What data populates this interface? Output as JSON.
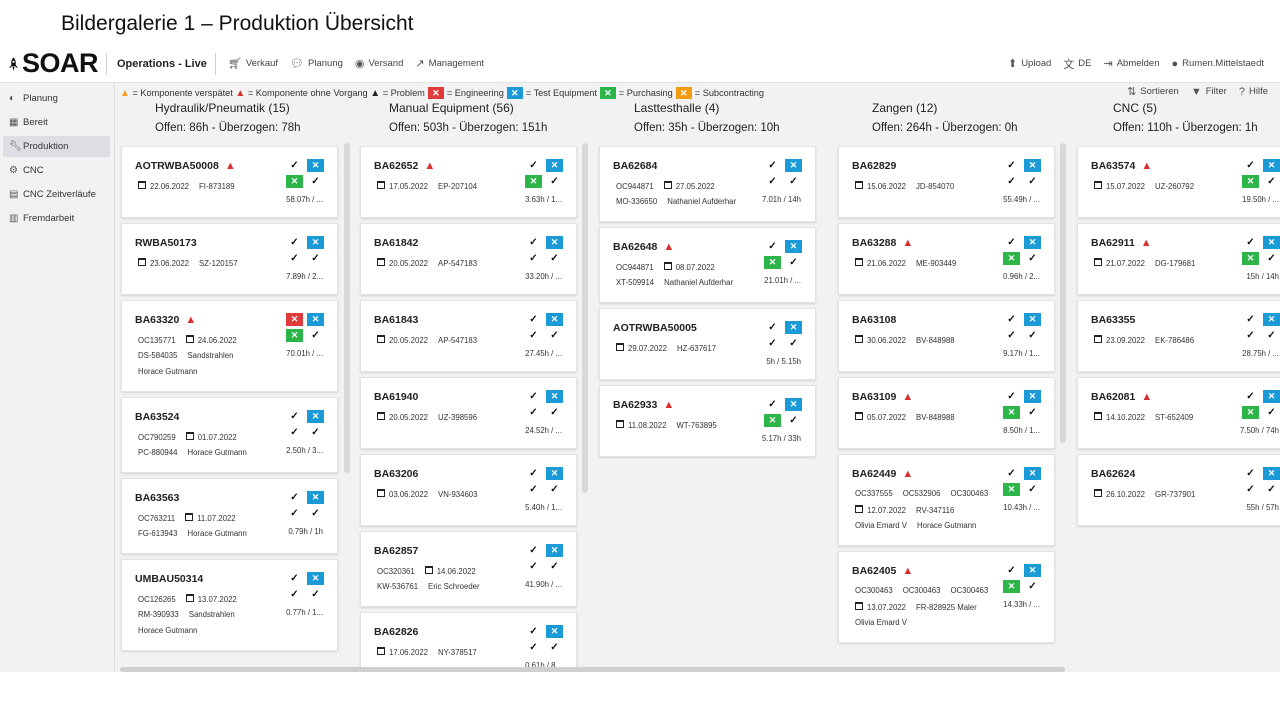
{
  "slide_title": "Bildergalerie 1 – Produktion Übersicht",
  "brand": "SOAR",
  "app_title": "Operations - Live",
  "nav": [
    {
      "label": "Verkauf",
      "icon": "cart-icon"
    },
    {
      "label": "Planung",
      "icon": "chat-icon"
    },
    {
      "label": "Versand",
      "icon": "globe-icon"
    },
    {
      "label": "Management",
      "icon": "trend-icon"
    }
  ],
  "top_right": [
    {
      "label": "Upload",
      "icon": "upload-icon"
    },
    {
      "label": "DE",
      "icon": "translate-icon"
    },
    {
      "label": "Abmelden",
      "icon": "logout-icon"
    },
    {
      "label": "Rumen.Mittelstaedt",
      "icon": "user-icon"
    }
  ],
  "sidebar": [
    {
      "label": "Planung",
      "icon": "palette-icon",
      "active": false
    },
    {
      "label": "Bereit",
      "icon": "pallet-icon",
      "active": false
    },
    {
      "label": "Produktion",
      "icon": "wrench-icon",
      "active": true
    },
    {
      "label": "CNC",
      "icon": "gears-icon",
      "active": false
    },
    {
      "label": "CNC Zeitverläufe",
      "icon": "calendar-icon",
      "active": false
    },
    {
      "label": "Fremdarbeit",
      "icon": "building-icon",
      "active": false
    }
  ],
  "legend": {
    "late": "= Komponente verspätet",
    "no_process": "= Komponente ohne Vorgang",
    "problem": "= Problem",
    "engineering": "= Engineering",
    "test_equipment": "= Test Equipment",
    "purchasing": "= Purchasing",
    "subcontracting": "= Subcontracting"
  },
  "tools": {
    "sort": "Sortieren",
    "filter": "Filter",
    "help": "Hilfe"
  },
  "colors": {
    "blue": "#1a9ad6",
    "red": "#e03b3b",
    "green": "#2db54a",
    "orange": "#f39c12"
  },
  "columns": [
    {
      "title": "Hydraulik/Pneumatik (15)",
      "summary": "Offen: 86h - Überzogen: 78h",
      "cards": [
        {
          "id": "AOTRWBA50008",
          "warn": true,
          "lines": [
            [
              "",
              "22.06.2022",
              "FI-873189"
            ]
          ],
          "flags": [
            "check",
            "x-blue",
            "x-green",
            "check"
          ],
          "hours": "58.07h / ..."
        },
        {
          "id": "RWBA50173",
          "warn": false,
          "lines": [
            [
              "",
              "23.06.2022",
              "SZ-120157"
            ]
          ],
          "flags": [
            "check",
            "x-blue",
            "check",
            "check"
          ],
          "hours": "7.89h / 2..."
        },
        {
          "id": "BA63320",
          "warn": true,
          "lines": [
            [
              "OC135771",
              "24.06.2022",
              ""
            ],
            [
              "DS-584035",
              "",
              "Sandstrahlen"
            ],
            [
              "Horace Gutmann",
              "",
              ""
            ]
          ],
          "flags": [
            "x-red",
            "x-blue",
            "x-green",
            "check"
          ],
          "hours": "70.01h / ..."
        },
        {
          "id": "BA63524",
          "warn": false,
          "lines": [
            [
              "OC790259",
              "01.07.2022",
              ""
            ],
            [
              "PC-880944",
              "",
              "Horace Gutmann"
            ]
          ],
          "flags": [
            "check",
            "x-blue",
            "check",
            "check"
          ],
          "hours": "2.50h / 3..."
        },
        {
          "id": "BA63563",
          "warn": false,
          "lines": [
            [
              "OC763211",
              "11.07.2022",
              ""
            ],
            [
              "FG-613943",
              "",
              "Horace Gutmann"
            ]
          ],
          "flags": [
            "check",
            "x-blue",
            "check",
            "check"
          ],
          "hours": "0.79h / 1h"
        },
        {
          "id": "UMBAU50314",
          "warn": false,
          "lines": [
            [
              "OC126265",
              "13.07.2022",
              ""
            ],
            [
              "RM-390933",
              "",
              "Sandstrahlen"
            ],
            [
              "Horace Gutmann",
              "",
              ""
            ]
          ],
          "flags": [
            "check",
            "x-blue",
            "check",
            "check"
          ],
          "hours": "0.77h / 1..."
        }
      ]
    },
    {
      "title": "Manual Equipment (56)",
      "summary": "Offen: 503h - Überzogen: 151h",
      "cards": [
        {
          "id": "BA62652",
          "warn": true,
          "lines": [
            [
              "",
              "17.05.2022",
              "EP-207104"
            ]
          ],
          "flags": [
            "check",
            "x-blue",
            "x-green",
            "check"
          ],
          "hours": "3.63h / 1..."
        },
        {
          "id": "BA61842",
          "warn": false,
          "lines": [
            [
              "",
              "20.05.2022",
              "AP-547183"
            ]
          ],
          "flags": [
            "check",
            "x-blue",
            "check",
            "check"
          ],
          "hours": "33.20h / ..."
        },
        {
          "id": "BA61843",
          "warn": false,
          "lines": [
            [
              "",
              "20.05.2022",
              "AP-547183"
            ]
          ],
          "flags": [
            "check",
            "x-blue",
            "check",
            "check"
          ],
          "hours": "27.45h / ..."
        },
        {
          "id": "BA61940",
          "warn": false,
          "lines": [
            [
              "",
              "20.05.2022",
              "UZ-398596"
            ]
          ],
          "flags": [
            "check",
            "x-blue",
            "check",
            "check"
          ],
          "hours": "24.52h / ..."
        },
        {
          "id": "BA63206",
          "warn": false,
          "lines": [
            [
              "",
              "03.06.2022",
              "VN-934603"
            ]
          ],
          "flags": [
            "check",
            "x-blue",
            "check",
            "check"
          ],
          "hours": "5.40h / 1..."
        },
        {
          "id": "BA62857",
          "warn": false,
          "lines": [
            [
              "OC320361",
              "14.06.2022",
              ""
            ],
            [
              "KW-536761",
              "",
              "Eric Schroeder"
            ]
          ],
          "flags": [
            "check",
            "x-blue",
            "check",
            "check"
          ],
          "hours": "41.90h / ..."
        },
        {
          "id": "BA62826",
          "warn": false,
          "lines": [
            [
              "",
              "17.06.2022",
              "NY-378517"
            ]
          ],
          "flags": [
            "check",
            "x-blue",
            "check",
            "check"
          ],
          "hours": "0.61h / 8..."
        }
      ]
    },
    {
      "title": "Lasttesthalle (4)",
      "summary": "Offen: 35h - Überzogen: 10h",
      "cards": [
        {
          "id": "BA62684",
          "warn": false,
          "lines": [
            [
              "OC944871",
              "27.05.2022",
              ""
            ],
            [
              "MO-336650",
              "",
              "Nathaniel Aufderhar"
            ]
          ],
          "flags": [
            "check",
            "x-blue",
            "check",
            "check"
          ],
          "hours": "7.01h / 14h"
        },
        {
          "id": "BA62648",
          "warn": true,
          "lines": [
            [
              "OC944871",
              "08.07.2022",
              ""
            ],
            [
              "XT-509914",
              "",
              "Nathaniel Aufderhar"
            ]
          ],
          "flags": [
            "check",
            "x-blue",
            "x-green",
            "check"
          ],
          "hours": "21.01h / ..."
        },
        {
          "id": "AOTRWBA50005",
          "warn": false,
          "lines": [
            [
              "",
              "29.07.2022",
              "HZ-637617"
            ]
          ],
          "flags": [
            "check",
            "x-blue",
            "check",
            "check"
          ],
          "hours": "5h / 5.15h"
        },
        {
          "id": "BA62933",
          "warn": true,
          "lines": [
            [
              "",
              "11.08.2022",
              "WT-763895"
            ]
          ],
          "flags": [
            "check",
            "x-blue",
            "x-green",
            "check"
          ],
          "hours": "5.17h / 33h"
        }
      ]
    },
    {
      "title": "Zangen (12)",
      "summary": "Offen: 264h - Überzogen: 0h",
      "cards": [
        {
          "id": "BA62829",
          "warn": false,
          "lines": [
            [
              "",
              "15.06.2022",
              "JD-854070"
            ]
          ],
          "flags": [
            "check",
            "x-blue",
            "check",
            "check"
          ],
          "hours": "55.49h / ..."
        },
        {
          "id": "BA63288",
          "warn": true,
          "lines": [
            [
              "",
              "21.06.2022",
              "ME-903449"
            ]
          ],
          "flags": [
            "check",
            "x-blue",
            "x-green",
            "check"
          ],
          "hours": "0.96h / 2..."
        },
        {
          "id": "BA63108",
          "warn": false,
          "lines": [
            [
              "",
              "30.06.2022",
              "BV-848988"
            ]
          ],
          "flags": [
            "check",
            "x-blue",
            "check",
            "check"
          ],
          "hours": "9.17h / 1..."
        },
        {
          "id": "BA63109",
          "warn": true,
          "lines": [
            [
              "",
              "05.07.2022",
              "BV-848988"
            ]
          ],
          "flags": [
            "check",
            "x-blue",
            "x-green",
            "check"
          ],
          "hours": "8.50h / 1..."
        },
        {
          "id": "BA62449",
          "warn": true,
          "lines": [
            [
              "OC337555",
              "OC532906",
              "OC300463"
            ],
            [
              "",
              "12.07.2022",
              "RV-347116"
            ],
            [
              "Olivia Emard V",
              "",
              "Horace Gutmann"
            ]
          ],
          "flags": [
            "check",
            "x-blue",
            "x-green",
            "check"
          ],
          "hours": "10.43h / ..."
        },
        {
          "id": "BA62405",
          "warn": true,
          "lines": [
            [
              "OC300463",
              "OC300463",
              "OC300463"
            ],
            [
              "",
              "13.07.2022",
              "FR-828925  Maler"
            ],
            [
              "Olivia Emard V",
              "",
              ""
            ]
          ],
          "flags": [
            "check",
            "x-blue",
            "x-green",
            "check"
          ],
          "hours": "14.33h / ..."
        }
      ]
    },
    {
      "title": "CNC (5)",
      "summary": "Offen: 110h - Überzogen: 1h",
      "cards": [
        {
          "id": "BA63574",
          "warn": true,
          "lines": [
            [
              "",
              "15.07.2022",
              "UZ-260792"
            ]
          ],
          "flags": [
            "check",
            "x-blue",
            "x-green",
            "check"
          ],
          "hours": "19.50h / ..."
        },
        {
          "id": "BA62911",
          "warn": true,
          "lines": [
            [
              "",
              "21.07.2022",
              "DG-179681"
            ]
          ],
          "flags": [
            "check",
            "x-blue",
            "x-green",
            "check"
          ],
          "hours": "15h / 14h"
        },
        {
          "id": "BA63355",
          "warn": false,
          "lines": [
            [
              "",
              "23.09.2022",
              "EK-786486"
            ]
          ],
          "flags": [
            "check",
            "x-blue",
            "check",
            "check"
          ],
          "hours": "28.75h / ..."
        },
        {
          "id": "BA62081",
          "warn": true,
          "lines": [
            [
              "",
              "14.10.2022",
              "ST-652409"
            ]
          ],
          "flags": [
            "check",
            "x-blue",
            "x-green",
            "check"
          ],
          "hours": "7.50h / 74h"
        },
        {
          "id": "BA62624",
          "warn": false,
          "lines": [
            [
              "",
              "26.10.2022",
              "GR-737901"
            ]
          ],
          "flags": [
            "check",
            "x-blue",
            "check",
            "check"
          ],
          "hours": "55h / 57h"
        }
      ]
    }
  ]
}
